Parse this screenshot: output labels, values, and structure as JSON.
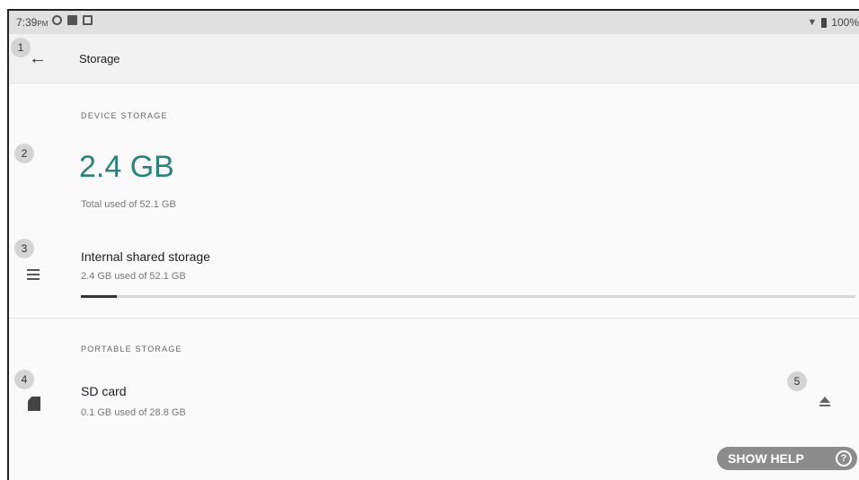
{
  "status_bar": {
    "time": "7:39",
    "ampm": "PM",
    "battery": "100%"
  },
  "app_bar": {
    "title": "Storage"
  },
  "markers": [
    "1",
    "2",
    "3",
    "4",
    "5"
  ],
  "device_storage": {
    "section_label": "DEVICE STORAGE",
    "used_total": "2.4 GB",
    "total_caption": "Total used of 52.1 GB"
  },
  "internal": {
    "title": "Internal shared storage",
    "subtitle": "2.4 GB used of 52.1 GB",
    "usage_fraction": 0.046
  },
  "portable_storage": {
    "section_label": "PORTABLE STORAGE",
    "sd_title": "SD card",
    "sd_subtitle": "0.1 GB used of 28.8 GB"
  },
  "help": {
    "label": "SHOW HELP",
    "icon_glyph": "?"
  },
  "colors": {
    "accent": "#26857a",
    "progress": "#333333"
  },
  "icons": {
    "back": "arrow-left-icon",
    "internal": "list-icon",
    "sd": "sd-card-icon",
    "eject": "eject-icon",
    "help": "question-icon"
  }
}
